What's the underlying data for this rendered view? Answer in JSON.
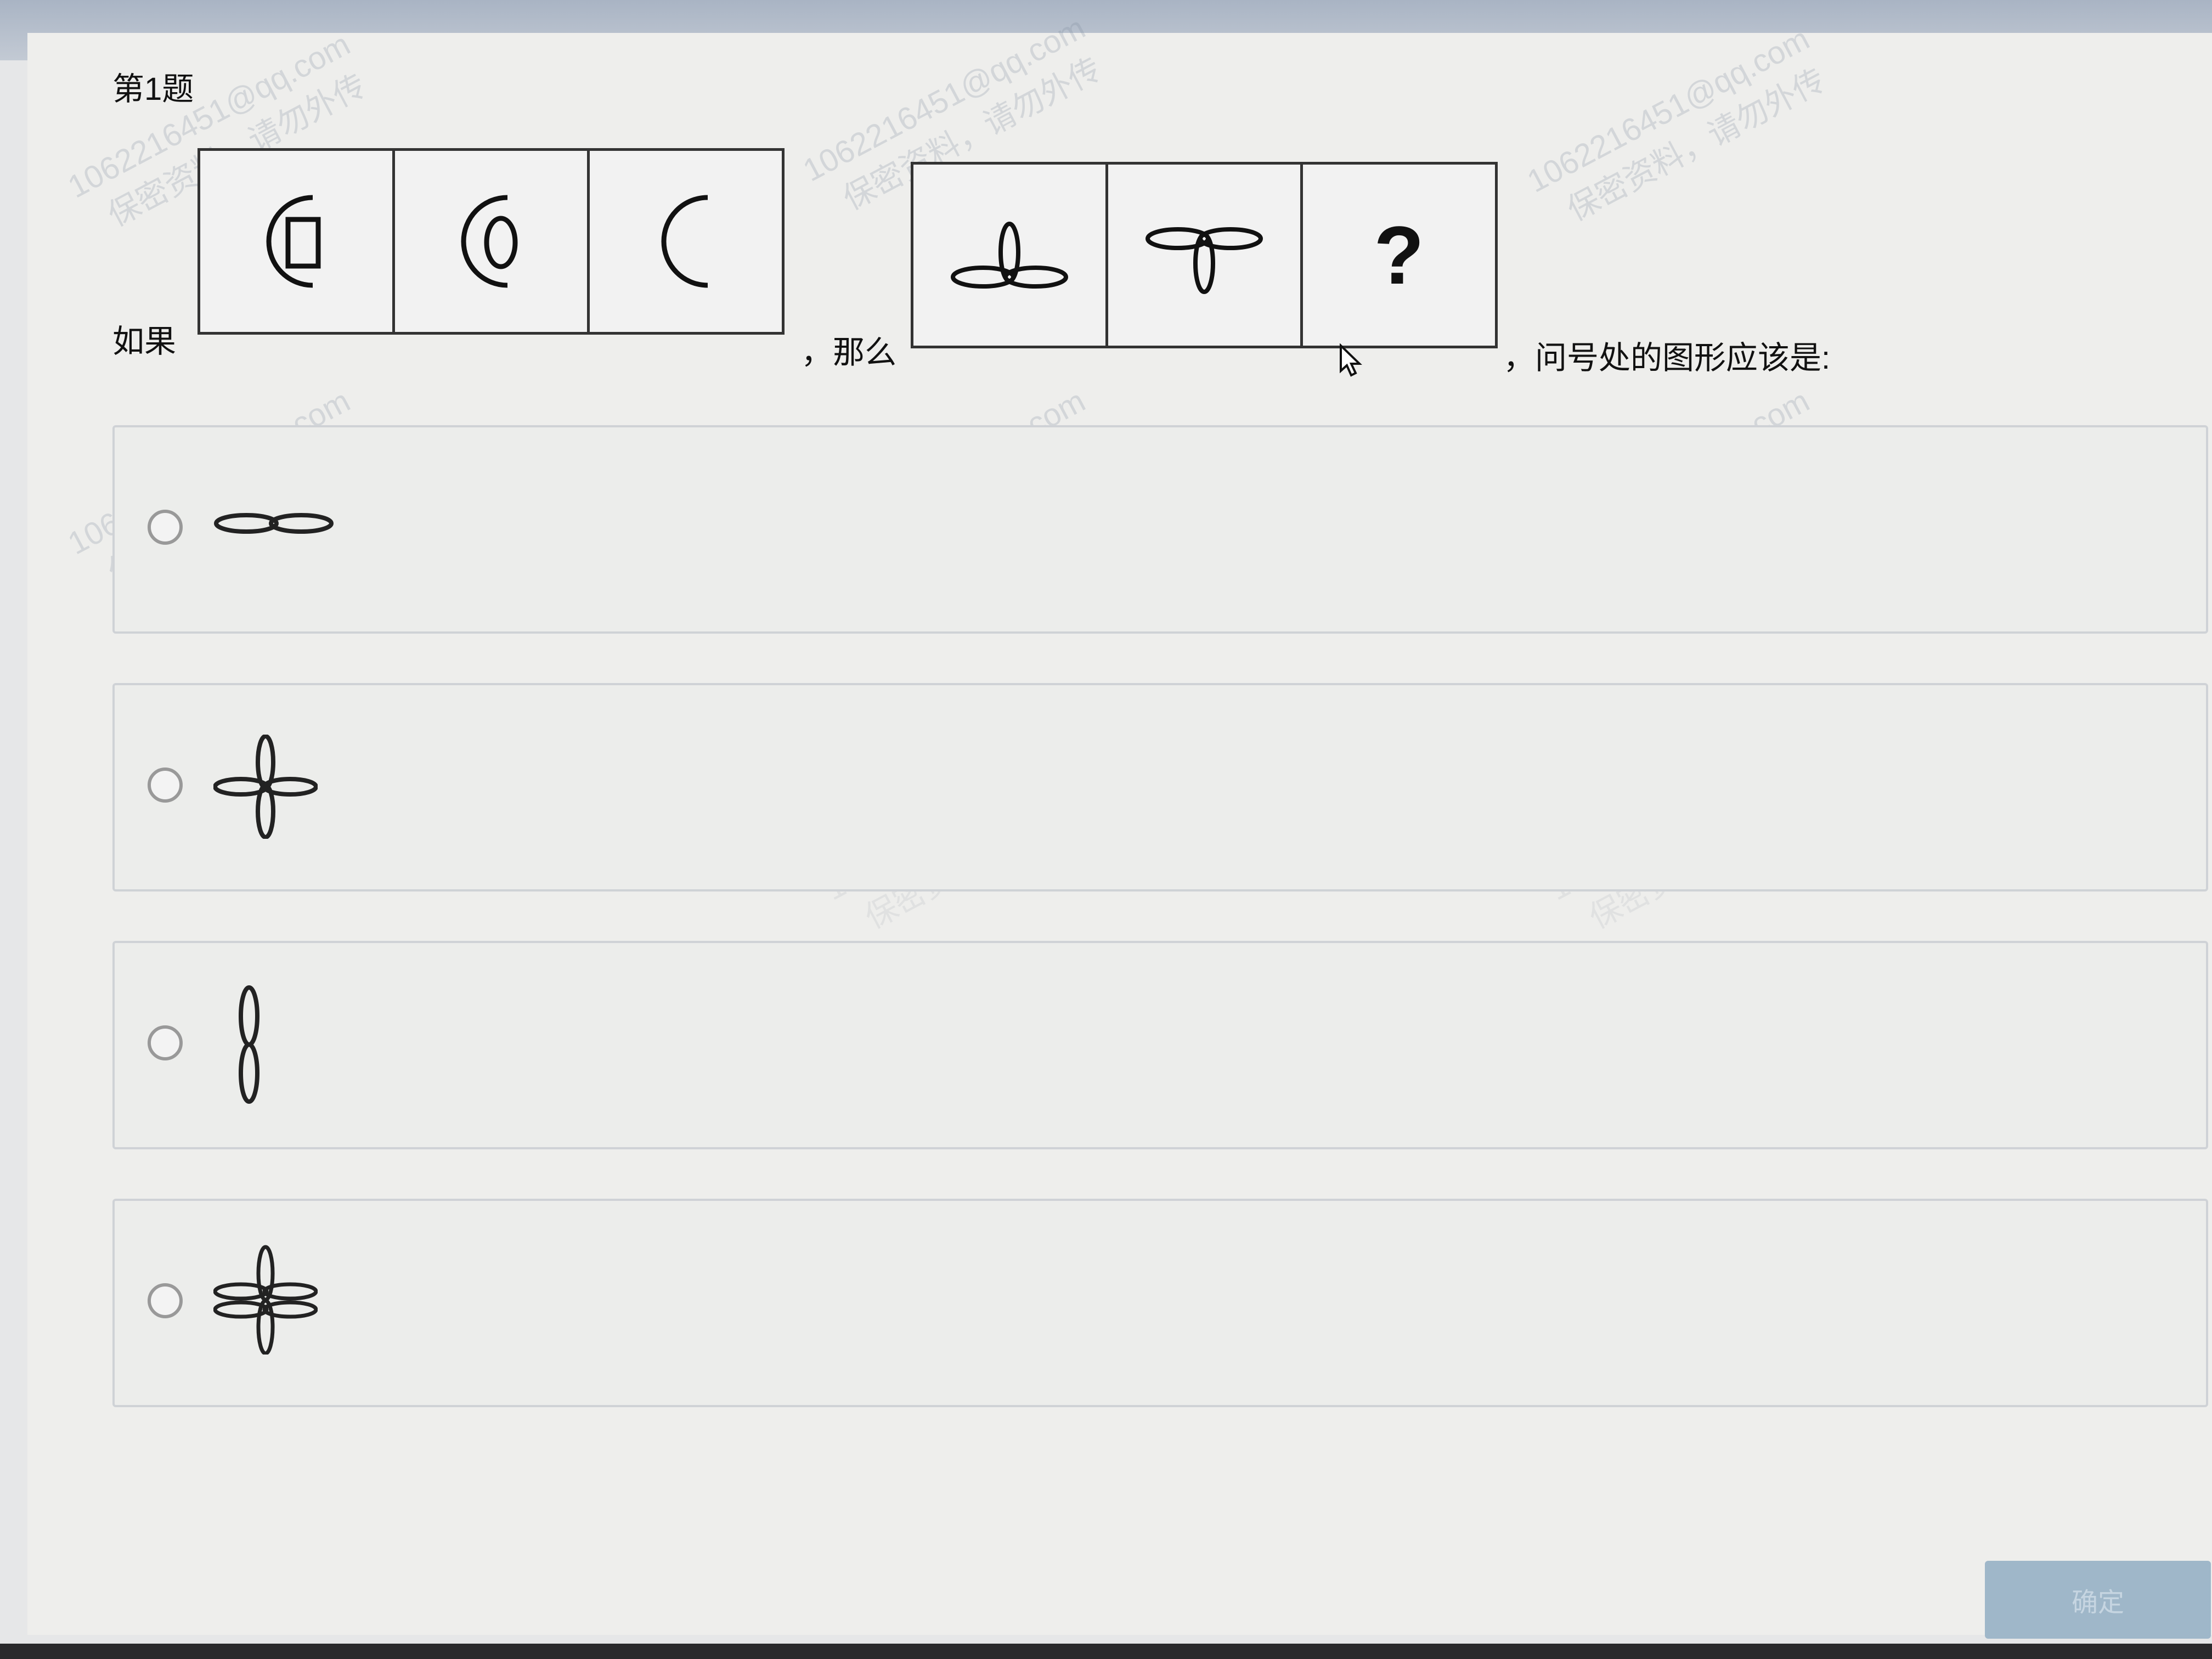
{
  "question": {
    "title": "第1题",
    "lead_if": "如果",
    "lead_then": "，那么",
    "lead_ask": "，问号处的图形应该是:",
    "question_mark": "?"
  },
  "watermark": {
    "line1": "1062216451@qq.com",
    "line2": "保密资料，请勿外传"
  },
  "options": [
    {
      "icon": "horizontal-two-petal-icon"
    },
    {
      "icon": "four-petal-cross-icon"
    },
    {
      "icon": "vertical-two-petal-icon"
    },
    {
      "icon": "six-petal-flower-icon"
    }
  ],
  "confirm_label": "确定"
}
